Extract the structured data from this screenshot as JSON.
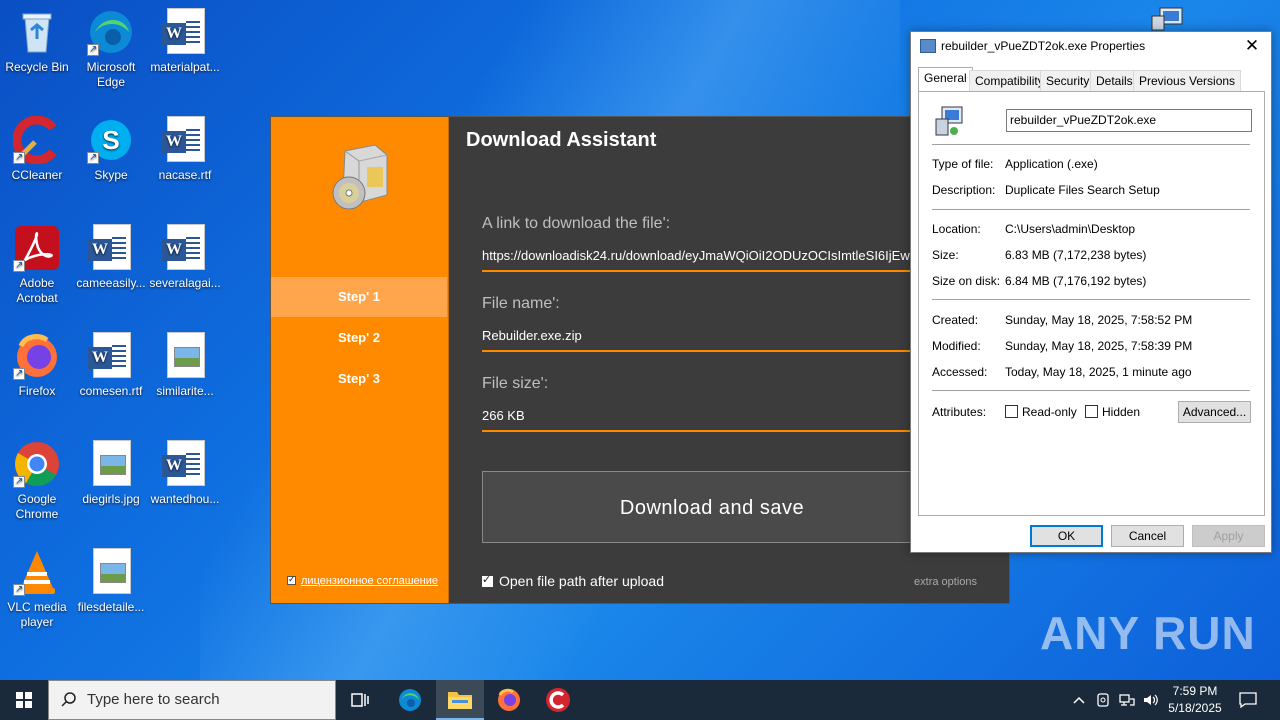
{
  "desktop": {
    "icons": [
      {
        "label": "Recycle Bin"
      },
      {
        "label": "Microsoft Edge"
      },
      {
        "label": "materialpat..."
      },
      {
        "label": "CCleaner"
      },
      {
        "label": "Skype"
      },
      {
        "label": "nacase.rtf"
      },
      {
        "label": "Adobe Acrobat"
      },
      {
        "label": "cameeasily..."
      },
      {
        "label": "severalagai..."
      },
      {
        "label": "Firefox"
      },
      {
        "label": "comesen.rtf"
      },
      {
        "label": "similarite..."
      },
      {
        "label": "Google Chrome"
      },
      {
        "label": "diegirls.jpg"
      },
      {
        "label": "wantedhou..."
      },
      {
        "label": "VLC media player"
      },
      {
        "label": "filesdetaile..."
      }
    ]
  },
  "assistant": {
    "title": "Download Assistant",
    "steps": [
      "Step' 1",
      "Step' 2",
      "Step' 3"
    ],
    "license_link": "лицензионное соглашение",
    "link_label": "A link to download the file':",
    "link_value": "https://downloadisk24.ru/download/eyJmaWQiOiI2ODUzOCIsImtleSI6IjEwN",
    "name_label": "File name':",
    "name_value": "Rebuilder.exe.zip",
    "size_label": "File size':",
    "size_value": "266 KB",
    "download_button": "Download and save",
    "open_path_label": "Open file path after upload",
    "extra_options": "extra options",
    "accent": "#ff8a00"
  },
  "properties": {
    "title": "rebuilder_vPueZDT2ok.exe Properties",
    "tabs": [
      "General",
      "Compatibility",
      "Security",
      "Details",
      "Previous Versions"
    ],
    "file_name": "rebuilder_vPueZDT2ok.exe",
    "type_key": "Type of file:",
    "type_val": "Application (.exe)",
    "desc_key": "Description:",
    "desc_val": "Duplicate Files Search Setup",
    "loc_key": "Location:",
    "loc_val": "C:\\Users\\admin\\Desktop",
    "size_key": "Size:",
    "size_val": "6.83 MB (7,172,238 bytes)",
    "disk_key": "Size on disk:",
    "disk_val": "6.84 MB (7,176,192 bytes)",
    "created_key": "Created:",
    "created_val": "Sunday, May 18, 2025, 7:58:52 PM",
    "modified_key": "Modified:",
    "modified_val": "Sunday, May 18, 2025, 7:58:39 PM",
    "accessed_key": "Accessed:",
    "accessed_val": "Today, May 18, 2025, 1 minute ago",
    "attr_key": "Attributes:",
    "readonly_label": "Read-only",
    "hidden_label": "Hidden",
    "advanced_button": "Advanced...",
    "ok_button": "OK",
    "cancel_button": "Cancel",
    "apply_button": "Apply"
  },
  "taskbar": {
    "search_placeholder": "Type here to search",
    "time": "7:59 PM",
    "date": "5/18/2025"
  },
  "watermark": "ANY RUN"
}
